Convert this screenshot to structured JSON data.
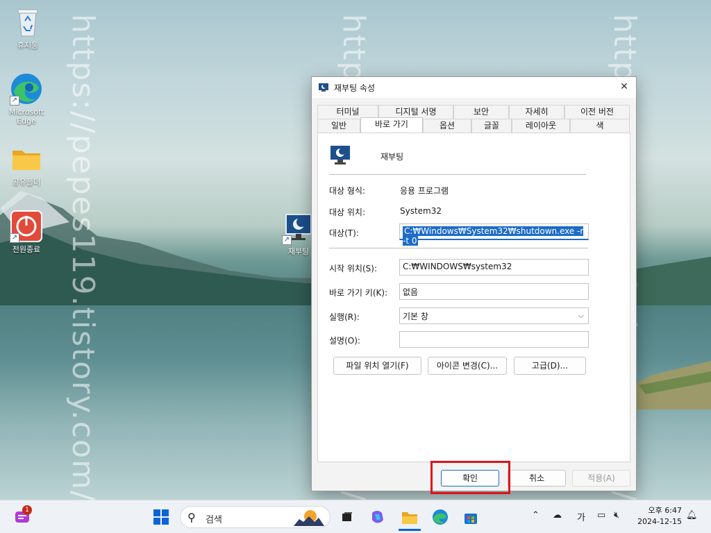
{
  "watermark": {
    "text": "https://pepes119.tistory.com/"
  },
  "desktop_icons": [
    {
      "label": "휴지통",
      "icon": "recycle-bin-icon"
    },
    {
      "label": "Microsoft Edge",
      "icon": "edge-icon"
    },
    {
      "label": "공유폴더",
      "icon": "folder-icon"
    },
    {
      "label": "전원종료",
      "icon": "power-icon"
    },
    {
      "label": "재부팅",
      "icon": "monitor-moon-icon"
    }
  ],
  "dialog": {
    "title": "재부팅 속성",
    "close_label": "✕",
    "tabs_row1": [
      "터미널",
      "디지털 서명",
      "보안",
      "자세히",
      "이전 버전"
    ],
    "tabs_row2": [
      "일반",
      "바로 가기",
      "옵션",
      "글꼴",
      "레이아웃",
      "색"
    ],
    "active_tab": "바로 가기",
    "app_name": "재부팅",
    "target_type_label": "대상 형식:",
    "target_type_value": "응용 프로그램",
    "target_location_label": "대상 위치:",
    "target_location_value": "System32",
    "target_label": "대상(T):",
    "target_value": "C:₩Windows₩System32₩shutdown.exe -r -t 0",
    "start_in_label": "시작 위치(S):",
    "start_in_value": "C:₩WINDOWS₩system32",
    "hotkey_label": "바로 가기 키(K):",
    "hotkey_value": "없음",
    "run_label": "실행(R):",
    "run_value": "기본 창",
    "comment_label": "설명(O):",
    "comment_value": "",
    "buttons": {
      "open_location": "파일 위치 열기(F)",
      "change_icon": "아이콘 변경(C)...",
      "advanced": "고급(D)..."
    },
    "footer": {
      "ok": "확인",
      "cancel": "취소",
      "apply": "적용(A)"
    }
  },
  "taskbar": {
    "search_placeholder": "검색",
    "notification_count": "1",
    "ime": "가",
    "time": "오후 6:47",
    "date": "2024-12-15"
  }
}
